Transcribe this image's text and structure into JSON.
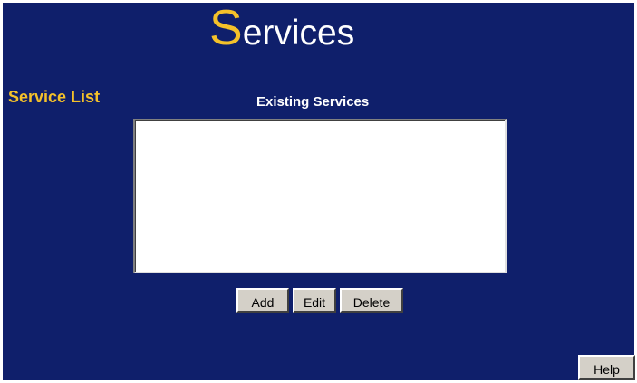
{
  "page": {
    "title_initial": "S",
    "title_rest": "ervices"
  },
  "section": {
    "label": "Service List"
  },
  "services": {
    "heading": "Existing Services",
    "items": []
  },
  "actions": {
    "add_label": "Add",
    "edit_label": "Edit",
    "delete_label": "Delete"
  },
  "help": {
    "label": "Help"
  },
  "colors": {
    "panel_background": "#0f1f6b",
    "accent": "#f4c12a",
    "button_face": "#d4d0c8"
  }
}
